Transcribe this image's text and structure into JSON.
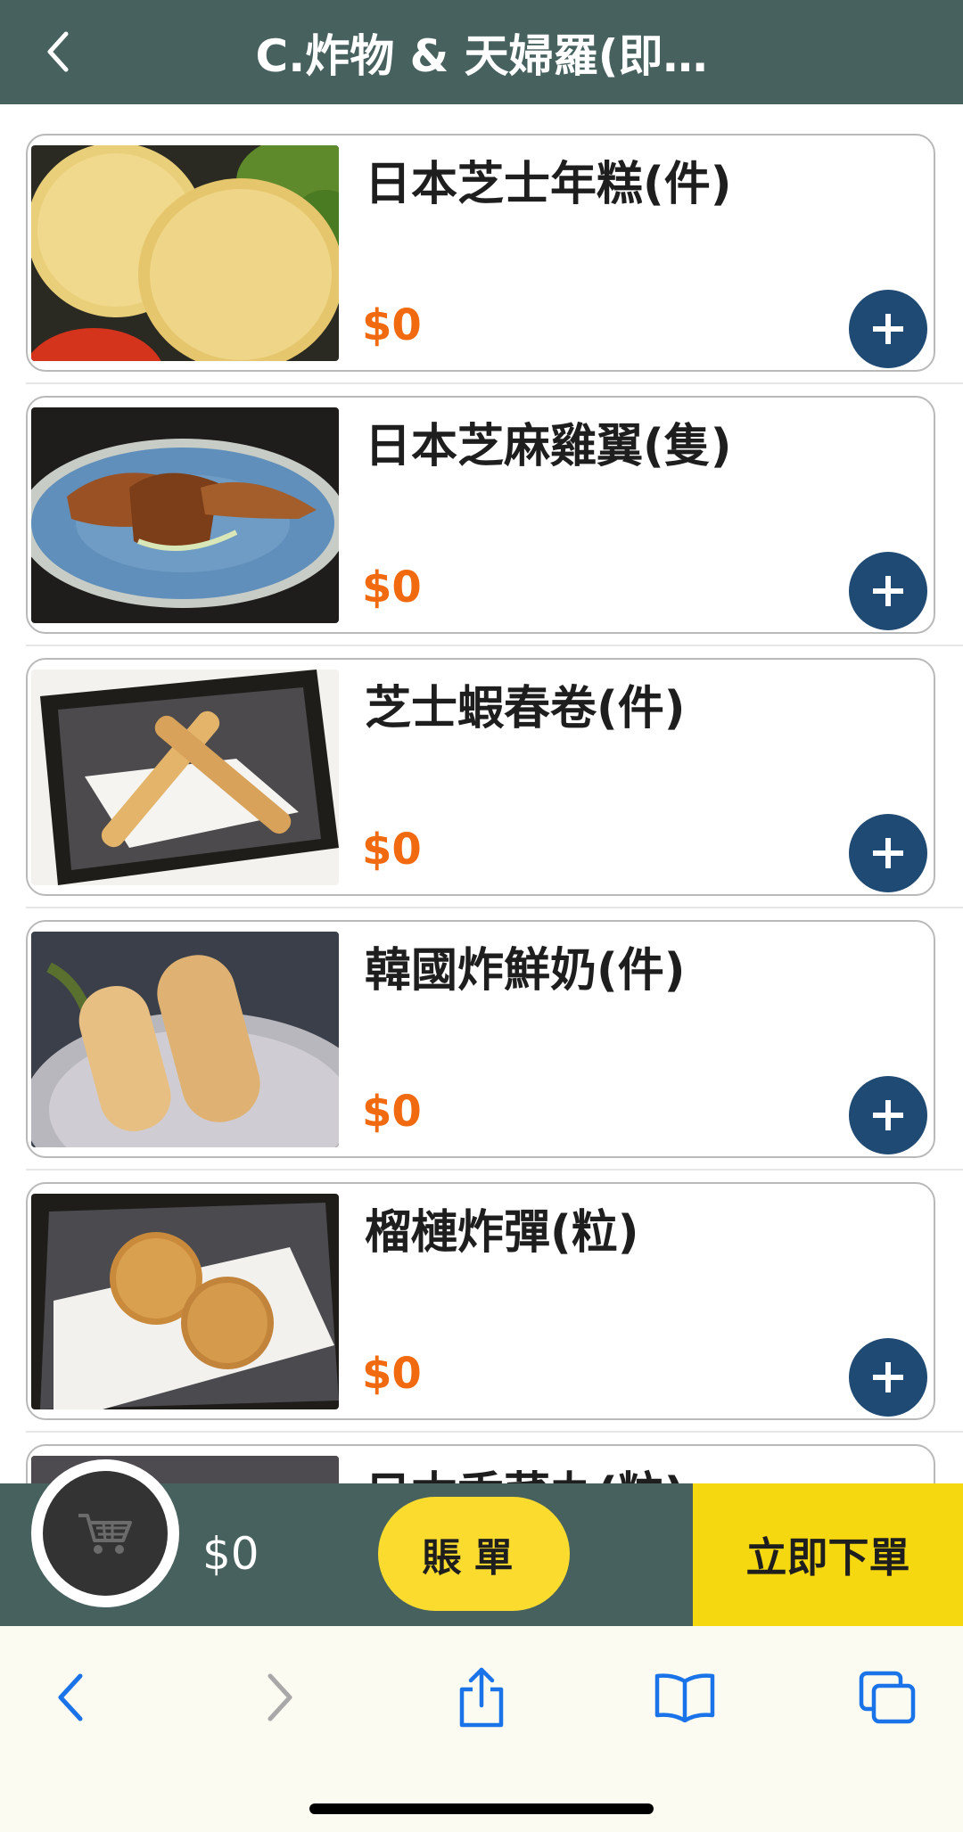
{
  "header": {
    "title": "C.炸物 & 天婦羅(即…",
    "back_icon": "chevron-left-icon"
  },
  "items": [
    {
      "name": "日本芝士年糕(件)",
      "price": "$0",
      "image": "cheese-rice-cake"
    },
    {
      "name": "日本芝麻雞翼(隻)",
      "price": "$0",
      "image": "sesame-chicken-wings"
    },
    {
      "name": "芝士蝦春卷(件)",
      "price": "$0",
      "image": "cheese-shrimp-spring-roll"
    },
    {
      "name": "韓國炸鮮奶(件)",
      "price": "$0",
      "image": "fried-fresh-milk"
    },
    {
      "name": "榴槤炸彈(粒)",
      "price": "$0",
      "image": "durian-bomb"
    },
    {
      "name": "日本香菜丸(粒)",
      "price": "",
      "image": "partial-item"
    }
  ],
  "cart": {
    "icon": "shopping-cart-icon",
    "total": "$0",
    "bill_label": "賬單",
    "order_label": "立即下單"
  },
  "colors": {
    "header_bg": "#47615e",
    "price": "#f26a10",
    "add_button": "#1f4a73",
    "bill_button": "#fbdc2e",
    "order_button": "#f5d80f",
    "ios_blue": "#1a73e8"
  },
  "toolbar": {
    "icons": [
      "back-arrow-icon",
      "forward-arrow-icon",
      "share-icon",
      "bookmarks-icon",
      "tabs-icon"
    ]
  }
}
